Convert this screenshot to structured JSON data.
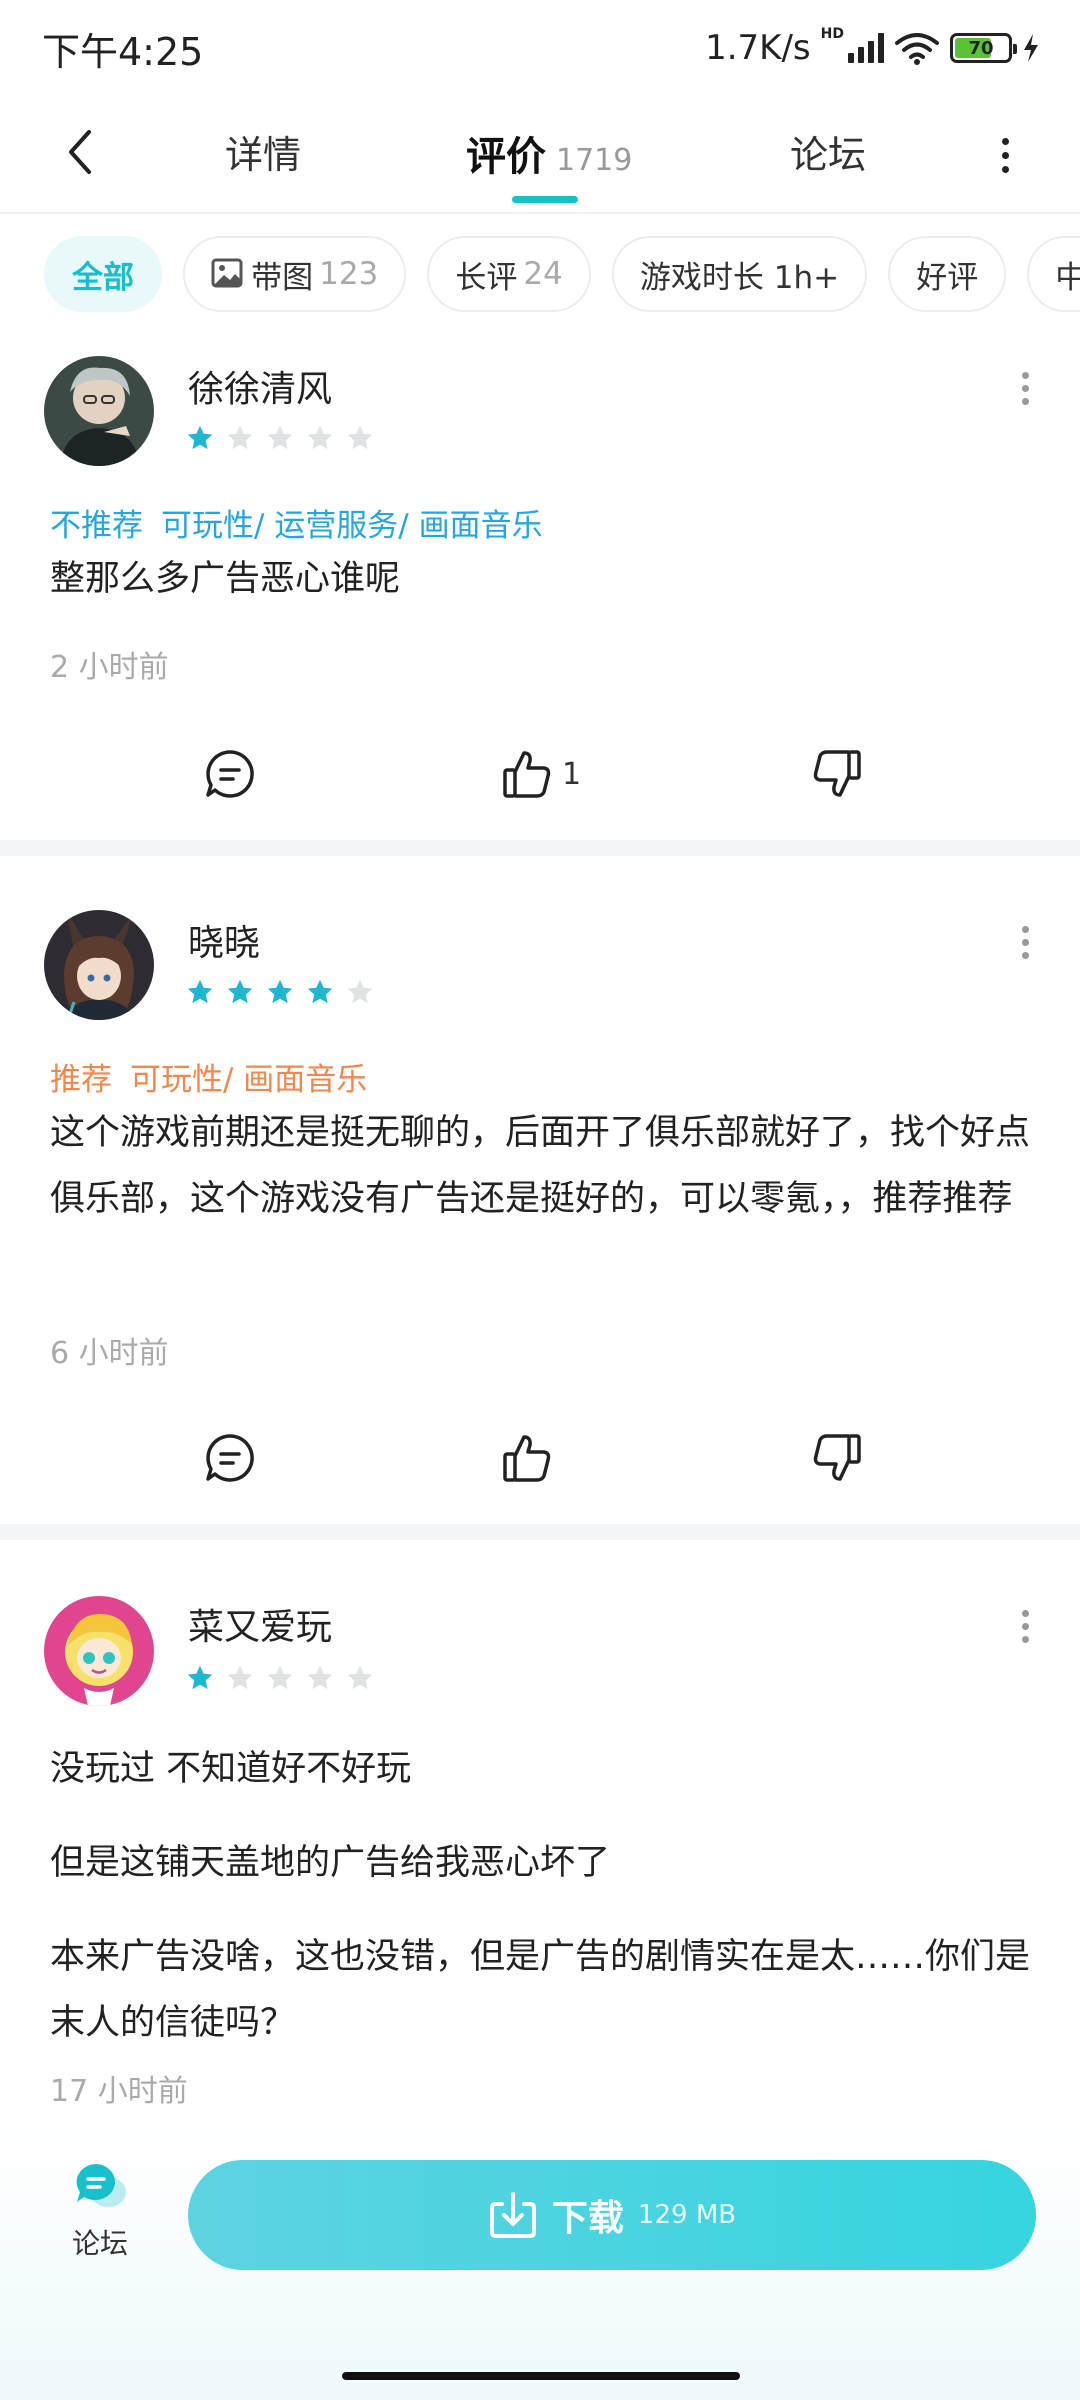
{
  "status_bar": {
    "time": "下午4:25",
    "net_speed": "1.7K/s",
    "hd": "HD",
    "battery": "70"
  },
  "nav": {
    "tabs": [
      {
        "label": "详情"
      },
      {
        "label": "评价",
        "count": "1719"
      },
      {
        "label": "论坛"
      }
    ]
  },
  "filters": [
    {
      "label": "全部",
      "count": ""
    },
    {
      "label": "带图",
      "count": "123"
    },
    {
      "label": "长评",
      "count": "24"
    },
    {
      "label": "游戏时长 1h+",
      "count": ""
    },
    {
      "label": "好评",
      "count": ""
    },
    {
      "label": "中评",
      "count": ""
    }
  ],
  "reviews": [
    {
      "user": "徐徐清风",
      "rating": 1,
      "tags": [
        "不推荐",
        "可玩性/ 运营服务/ 画面音乐"
      ],
      "paragraphs": [
        "整那么多广告恶心谁呢"
      ],
      "time": "2 小时前",
      "likes": "1"
    },
    {
      "user": "晓晓",
      "rating": 4,
      "tags": [
        "推荐",
        "可玩性/ 画面音乐"
      ],
      "paragraphs": [
        "这个游戏前期还是挺无聊的，后面开了俱乐部就好了，找个好点俱乐部，这个游戏没有广告还是挺好的，可以零氪，，推荐推荐"
      ],
      "time": "6 小时前",
      "likes": ""
    },
    {
      "user": "菜又爱玩",
      "rating": 1,
      "tags": [],
      "paragraphs": [
        "没玩过 不知道好不好玩",
        "但是这铺天盖地的广告给我恶心坏了",
        "本来广告没啥，这也没错，但是广告的剧情实在是太……你们是末人的信徒吗？"
      ],
      "time": "17 小时前",
      "likes": ""
    }
  ],
  "bottom": {
    "forum_label": "论坛",
    "download_label": "下载",
    "download_size": "129 MB"
  },
  "colors": {
    "accent": "#19c0cc",
    "star": "#1fb8d2",
    "tag_negative": "#25a6e0",
    "tag_positive": "#f0884e"
  }
}
